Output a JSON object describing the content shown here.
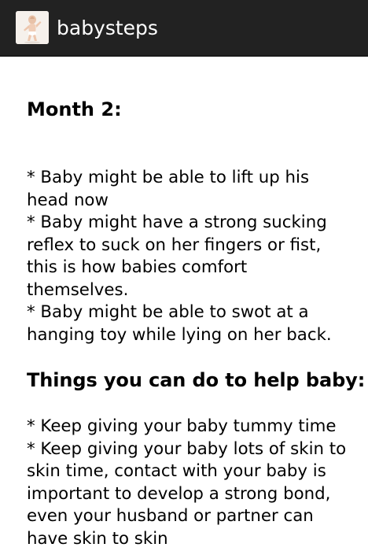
{
  "app": {
    "title": "babysteps",
    "icon": "baby-photo-icon"
  },
  "content": {
    "heading_month": "Month 2:",
    "milestones_lines": [
      "* Baby might be able to lift up his",
      "head now",
      "* Baby might have a strong sucking",
      "reflex to suck on her fingers or fist,",
      "this is how babies comfort",
      "themselves.",
      "* Baby might be able to swot at a",
      "hanging toy while lying on her back."
    ],
    "heading_help": "Things you can do to help baby:",
    "help_lines": [
      "* Keep giving your baby tummy time",
      "* Keep giving your baby lots of skin to",
      "skin time, contact with your baby is",
      "important to develop a strong bond,",
      "even your husband or partner can",
      "have skin to skin"
    ]
  },
  "colors": {
    "action_bar": "#222222",
    "title_text": "#ffffff",
    "body_text": "#000000",
    "background": "#ffffff"
  }
}
